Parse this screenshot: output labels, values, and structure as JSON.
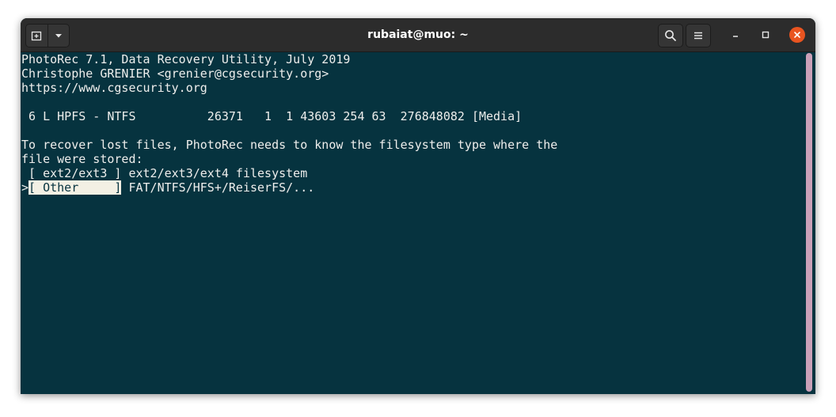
{
  "window": {
    "title": "rubaiat@muo: ~"
  },
  "icons": {
    "new_tab": "new-tab-icon",
    "tab_menu": "chevron-down-icon",
    "search": "search-icon",
    "menu": "hamburger-menu-icon",
    "minimize": "minimize-icon",
    "maximize": "maximize-icon",
    "close": "close-icon"
  },
  "colors": {
    "terminal_bg": "#06333f",
    "terminal_fg": "#eeeeec",
    "selection_bg": "#f3f0e4",
    "close_button": "#e95420",
    "scrollbar": "#c9a0b8"
  },
  "terminal": {
    "header": [
      "PhotoRec 7.1, Data Recovery Utility, July 2019",
      "Christophe GRENIER <grenier@cgsecurity.org>",
      "https://www.cgsecurity.org"
    ],
    "partition": " 6 L HPFS - NTFS          26371   1  1 43603 254 63  276848082 [Media]",
    "prompt": [
      "To recover lost files, PhotoRec needs to know the filesystem type where the",
      "file were stored:"
    ],
    "options": [
      {
        "prefix": " ",
        "label": "[ ext2/ext3 ]",
        "description": " ext2/ext3/ext4 filesystem"
      },
      {
        "prefix": ">",
        "label": "[ Other     ]",
        "description": " FAT/NTFS/HFS+/ReiserFS/..."
      }
    ]
  }
}
